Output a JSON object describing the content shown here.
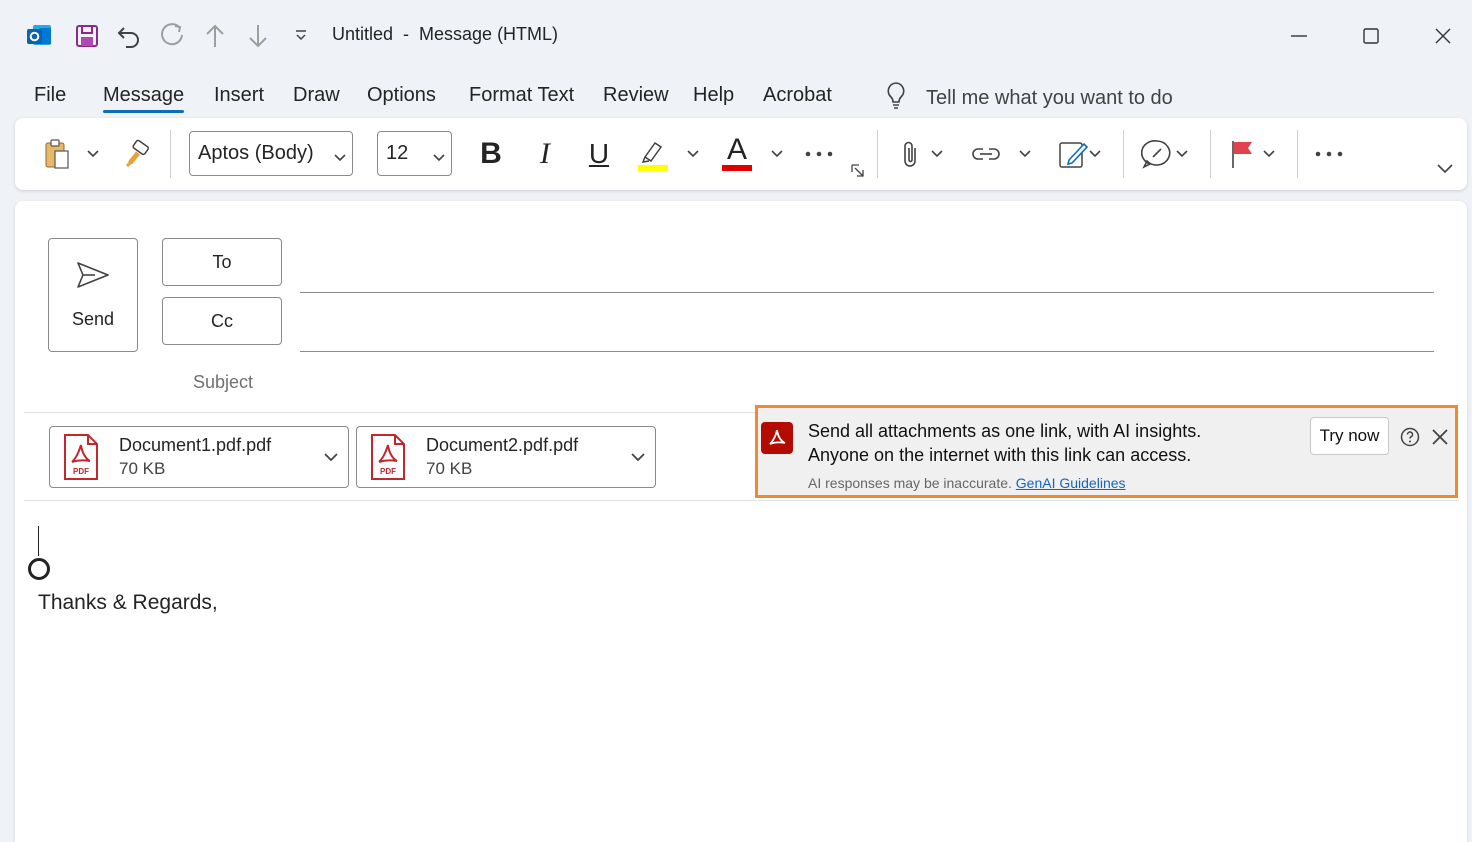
{
  "window": {
    "title": "Untitled  -  Message (HTML)",
    "icons": [
      "outlook-icon",
      "save-icon",
      "undo-icon",
      "redo-icon",
      "up-arrow-icon",
      "down-arrow-icon",
      "customize-qat-icon"
    ],
    "controls": [
      "minimize-icon",
      "maximize-icon",
      "close-icon"
    ]
  },
  "menu": {
    "items": [
      "File",
      "Message",
      "Insert",
      "Draw",
      "Options",
      "Format Text",
      "Review",
      "Help",
      "Acrobat"
    ],
    "active": "Message",
    "tell_me": "Tell me what you want to do"
  },
  "ribbon": {
    "font_name": "Aptos (Body)",
    "font_size": "12",
    "bold": "B",
    "italic": "I",
    "underline": "U",
    "font_color": "A",
    "highlight_color": "#ffff00",
    "text_color": "#e00000"
  },
  "compose": {
    "send_label": "Send",
    "to_label": "To",
    "cc_label": "Cc",
    "subject_label": "Subject",
    "attachments": [
      {
        "name": "Document1.pdf.pdf",
        "size": "70 KB"
      },
      {
        "name": "Document2.pdf.pdf",
        "size": "70 KB"
      }
    ],
    "body_signoff": "Thanks & Regards,"
  },
  "banner": {
    "line1": "Send all attachments as one link, with AI insights.",
    "line2": "Anyone on the internet with this link can access.",
    "note": "AI responses may be inaccurate.",
    "link": "GenAI Guidelines",
    "button": "Try now",
    "border_color": "#f0892f",
    "logo_color": "#b30b00"
  }
}
